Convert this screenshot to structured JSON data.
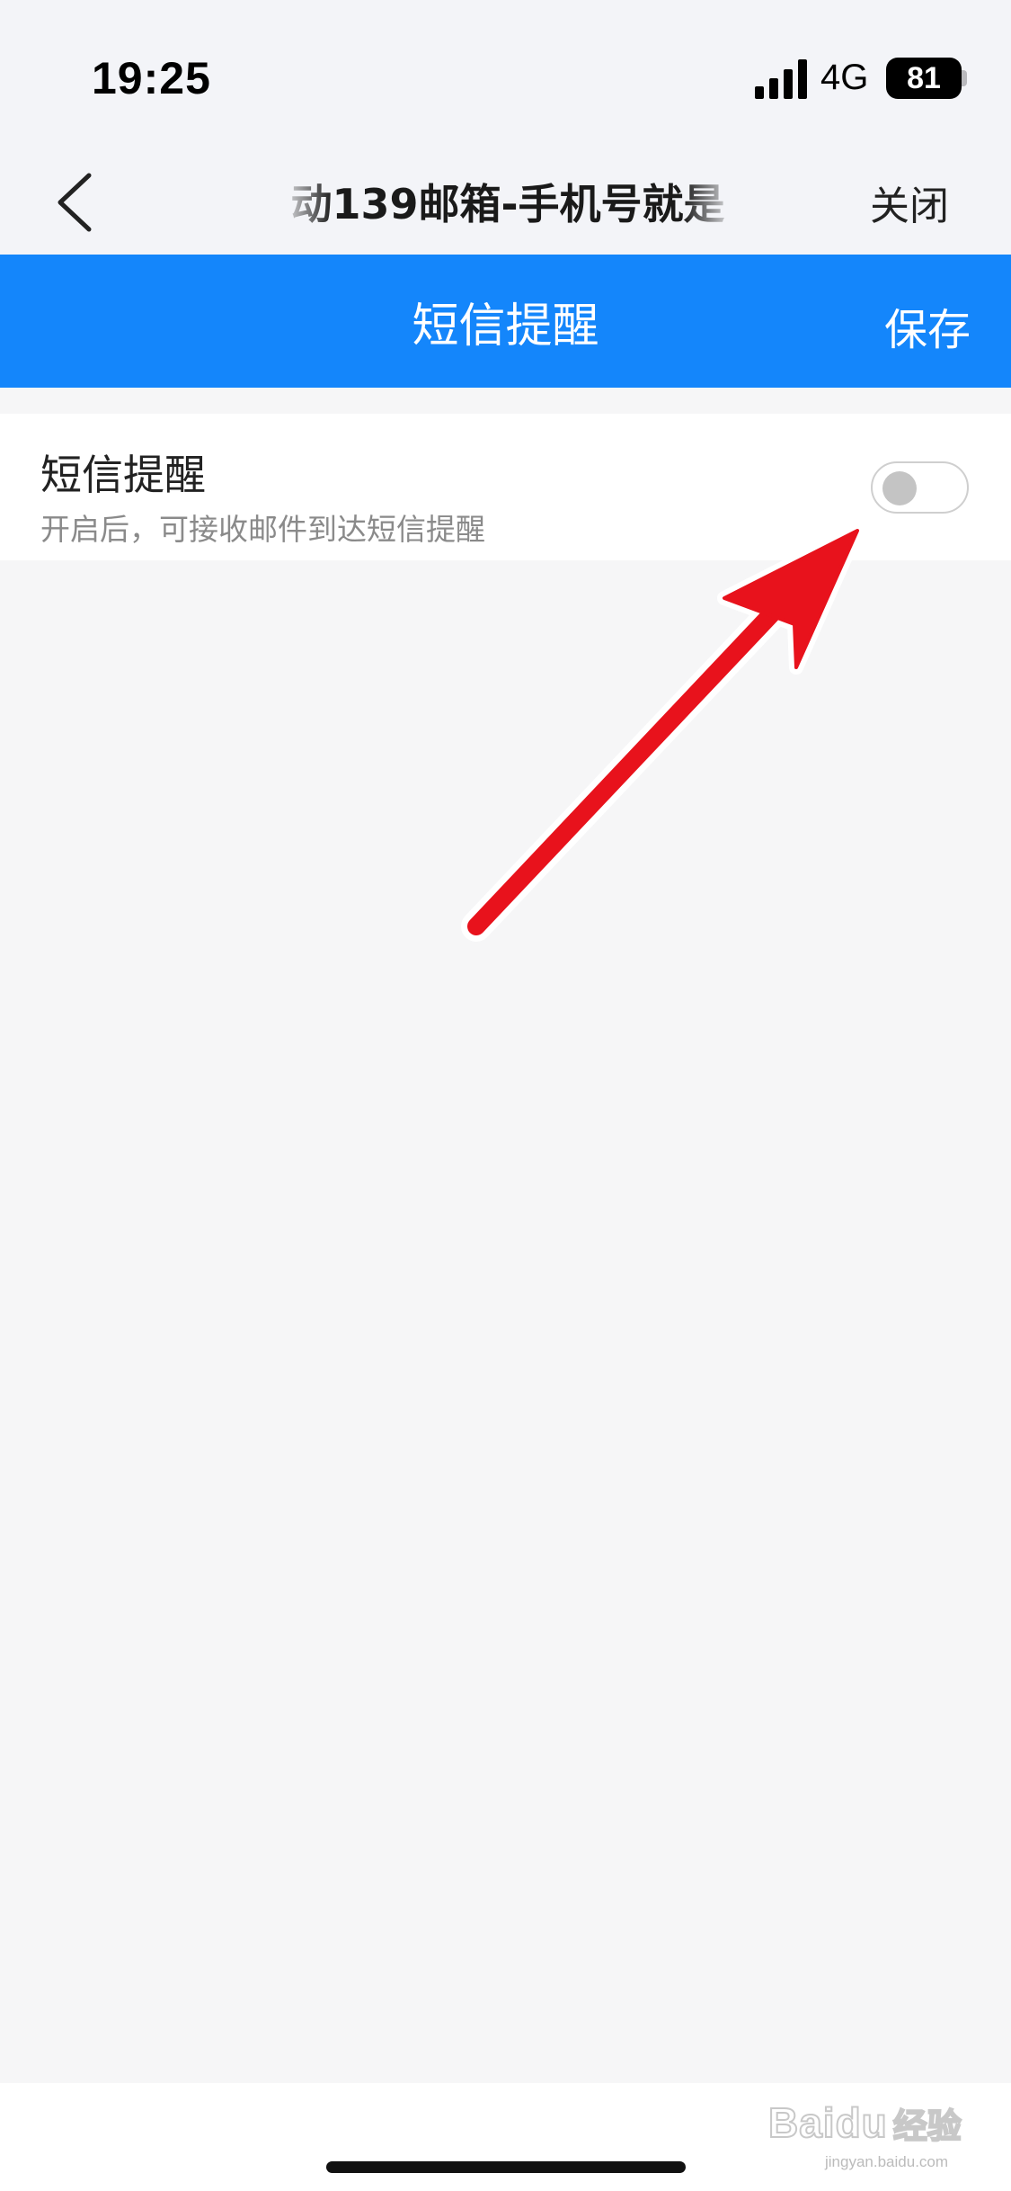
{
  "status_bar": {
    "time": "19:25",
    "network": "4G",
    "battery": "81",
    "icons": [
      "signal-icon",
      "battery-icon"
    ]
  },
  "nav": {
    "title": "动139邮箱-手机号就是",
    "close_label": "关闭",
    "back_icon": "chevron-left-icon"
  },
  "header": {
    "title": "短信提醒",
    "save_label": "保存",
    "background_color": "#1486fb"
  },
  "setting": {
    "title": "短信提醒",
    "description": "开启后，可接收邮件到达短信提醒",
    "toggle_on": false
  },
  "annotation": {
    "type": "red-arrow",
    "color": "#e8121c",
    "points_to": "sms-reminder-toggle"
  },
  "watermark": {
    "logo": "Baidu",
    "text": "经验",
    "domain": "jingyan.baidu.com"
  }
}
